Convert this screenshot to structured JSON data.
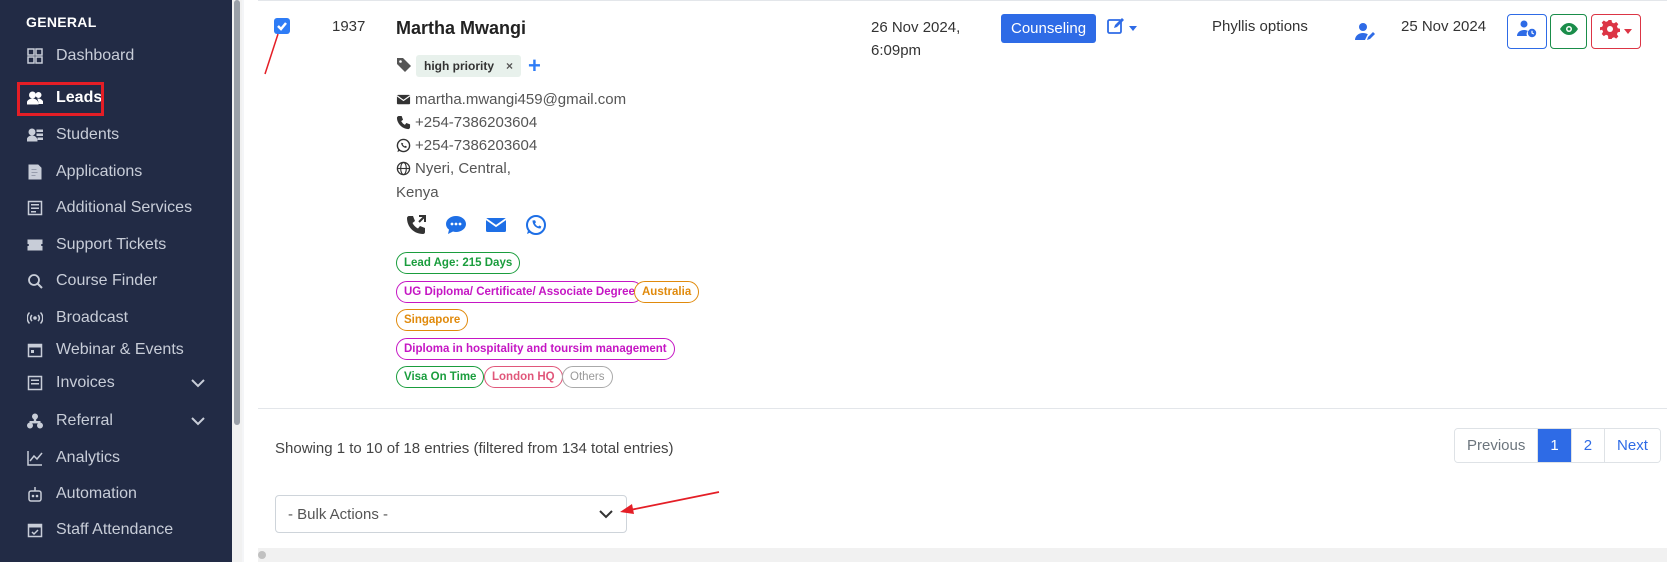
{
  "sidebar": {
    "section_title": "GENERAL",
    "items": [
      {
        "label": "Dashboard",
        "icon": "grid-icon"
      },
      {
        "label": "Leads",
        "icon": "users-icon",
        "active": true
      },
      {
        "label": "Students",
        "icon": "student-list-icon"
      },
      {
        "label": "Applications",
        "icon": "document-icon"
      },
      {
        "label": "Additional Services",
        "icon": "services-icon"
      },
      {
        "label": "Support Tickets",
        "icon": "ticket-icon"
      },
      {
        "label": "Course Finder",
        "icon": "search-icon"
      },
      {
        "label": "Broadcast",
        "icon": "broadcast-icon"
      },
      {
        "label": "Webinar & Events",
        "icon": "calendar-icon"
      },
      {
        "label": "Invoices",
        "icon": "invoice-icon",
        "expandable": true
      },
      {
        "label": "Referral",
        "icon": "referral-icon",
        "expandable": true
      },
      {
        "label": "Analytics",
        "icon": "chart-line-icon"
      },
      {
        "label": "Automation",
        "icon": "robot-icon"
      },
      {
        "label": "Staff Attendance",
        "icon": "calendar-check-icon"
      }
    ]
  },
  "lead": {
    "checked": true,
    "id": "1937",
    "name": "Martha Mwangi",
    "tag": "high priority",
    "tag_remove": "×",
    "add_tag": "+",
    "email": "martha.mwangi459@gmail.com",
    "phone": "+254-7386203604",
    "whatsapp": "+254-7386203604",
    "location_line1": "Nyeri, Central,",
    "location_line2": "Kenya",
    "badges": {
      "lead_age": "Lead Age: 215 Days",
      "degree": "UG Diploma/ Certificate/ Associate Degree",
      "country1": "Australia",
      "country2": "Singapore",
      "course": "Diploma in hospitality and toursim management",
      "source": "Visa On Time",
      "branch": "London HQ",
      "other": "Others"
    },
    "created_date": "26 Nov 2024,",
    "created_time": "6:09pm",
    "status": "Counseling",
    "assignee": "Phyllis options",
    "followup_date": "25 Nov 2024"
  },
  "footer": {
    "entries_text": "Showing 1 to 10 of 18 entries (filtered from 134 total entries)",
    "pager": {
      "previous": "Previous",
      "page1": "1",
      "page2": "2",
      "next": "Next"
    },
    "bulk_actions": "- Bulk Actions -"
  },
  "colors": {
    "sidebar_bg": "#222b45",
    "primary": "#2e6be6",
    "active_outline": "#e41e26",
    "annotation_arrow": "#e41e26"
  }
}
